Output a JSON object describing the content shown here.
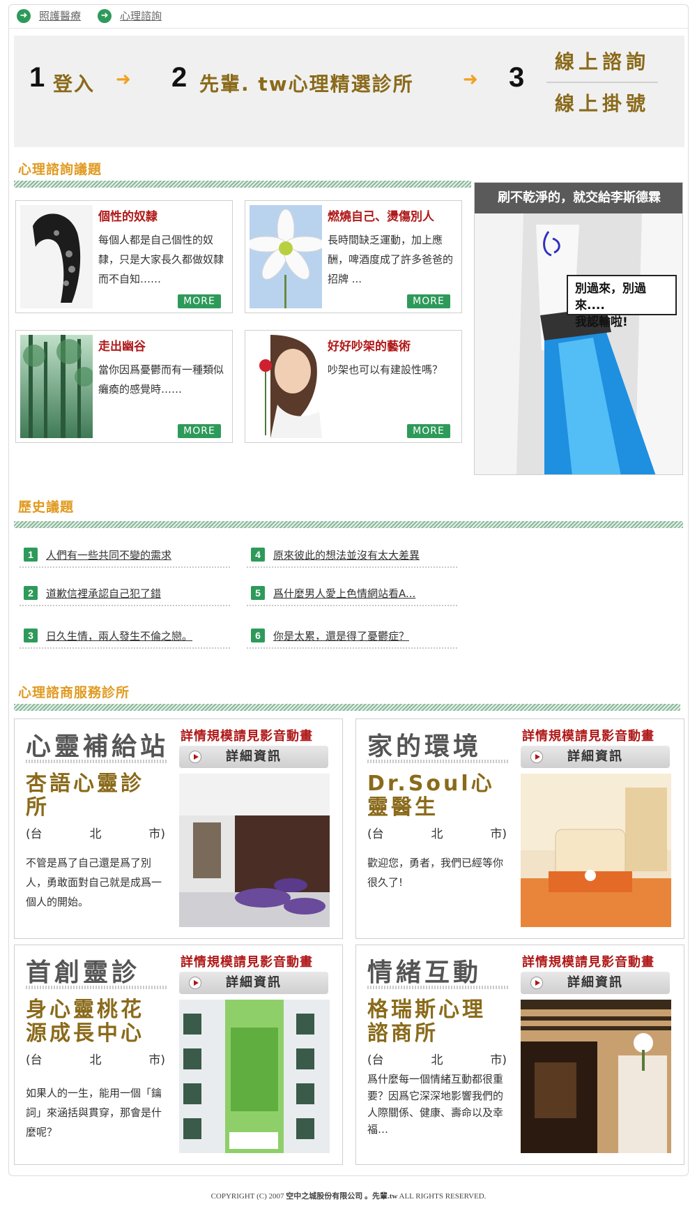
{
  "breadcrumb": [
    "照護醫療",
    "心理諮詢"
  ],
  "steps": {
    "step1_num": "1",
    "step1_text": "登入",
    "step2_num": "2",
    "step2_text": "先輩. tw心理精選診所",
    "step3_num": "3",
    "step3_option1": "線上諮詢",
    "step3_option2": "線上掛號"
  },
  "topics_section": {
    "title": "心理諮詢議題",
    "cards": [
      {
        "title": "個性的奴隸",
        "body": "每個人都是自己個性的奴隸，只是大家長久都做奴隸而不自知……",
        "more": "MORE"
      },
      {
        "title": "燃燒自己、燙傷別人",
        "body": "長時間缺乏運動，加上應酬，啤酒度成了許多爸爸的招牌 ...",
        "more": "MORE"
      },
      {
        "title": "走出幽谷",
        "body": "當你因爲憂鬱而有一種類似癱瘓的感覺時……",
        "more": "MORE"
      },
      {
        "title": "好好吵架的藝術",
        "body": "吵架也可以有建設性嗎？",
        "more": "MORE"
      }
    ]
  },
  "ad": {
    "headline": "刷不乾淨的，就交給李斯德霖",
    "bubble_line1": "別過來，別過來....",
    "bubble_line2": "我認輸啦!"
  },
  "history_section": {
    "title": "歷史議題",
    "items": [
      {
        "num": "1",
        "text": "人們有一些共同不變的需求"
      },
      {
        "num": "2",
        "text": "道歉信裡承認自己犯了錯"
      },
      {
        "num": "3",
        "text": "日久生情，兩人發生不倫之戀。"
      },
      {
        "num": "4",
        "text": "原來彼此的想法並沒有太大差異"
      },
      {
        "num": "5",
        "text": "爲什麼男人愛上色情網站看A..."
      },
      {
        "num": "6",
        "text": "你是太累，還是得了憂鬱症？"
      }
    ]
  },
  "clinics_section": {
    "title": "心理諮商服務診所",
    "clinics": [
      {
        "category": "心靈補給站",
        "note": "詳情規模請見影音動畫",
        "button": "詳細資訊",
        "name": "杏語心靈診所",
        "city_parts": [
          "(台",
          "北",
          "市)"
        ],
        "desc": "不管是爲了自己還是爲了別人，勇敢面對自己就是成爲一個人的開始。"
      },
      {
        "category": "家的環境",
        "note": "詳情規模請見影音動畫",
        "button": "詳細資訊",
        "name": "Dr.Soul心靈醫生",
        "city_parts": [
          "(台",
          "北",
          "市)"
        ],
        "desc": "歡迎您，勇者，我們已經等你很久了!"
      },
      {
        "category": "首創靈診",
        "note": "詳情規模請見影音動畫",
        "button": "詳細資訊",
        "name": "身心靈桃花源成長中心",
        "city_parts": [
          "(台",
          "北",
          "市)"
        ],
        "desc": "如果人的一生，能用一個「鑰詞」來涵括與貫穿，那會是什麼呢？"
      },
      {
        "category": "情緒互動",
        "note": "詳情規模請見影音動畫",
        "button": "詳細資訊",
        "name": "格瑞斯心理諮商所",
        "city_parts": [
          "(台",
          "北",
          "市)"
        ],
        "desc": "爲什麼每一個情緒互動都很重要？因爲它深深地影響我們的人際關係、健康、壽命以及幸福…"
      }
    ]
  },
  "footer": {
    "pre": "COPYRIGHT (C) 2007",
    "company": "空中之城股份有限公司 。先輩.tw",
    "post": "ALL RIGHTS RESERVED."
  }
}
